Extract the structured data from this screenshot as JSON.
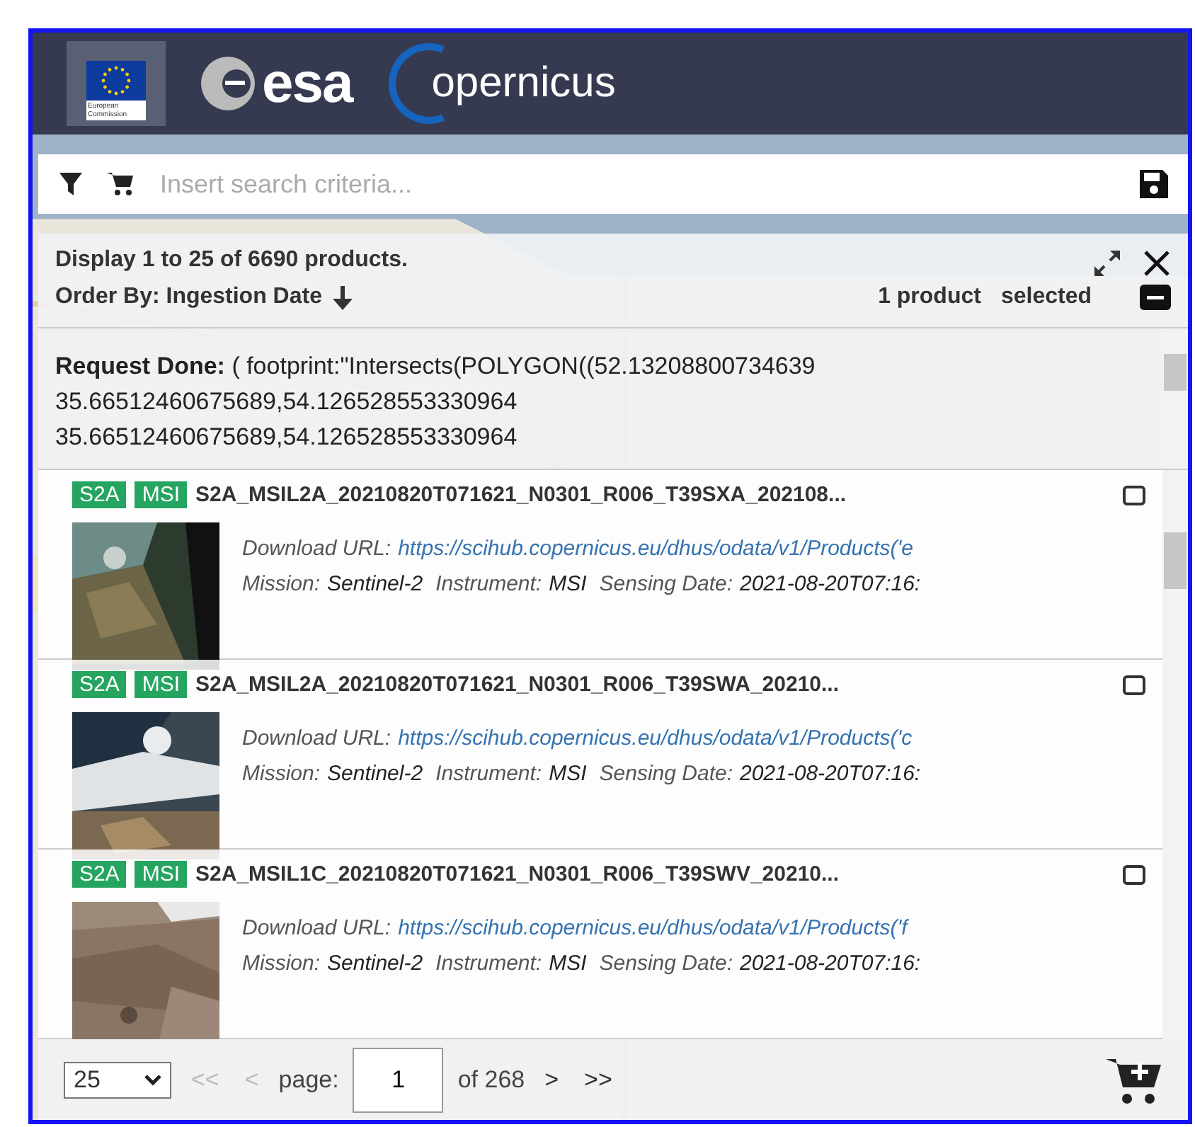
{
  "header": {
    "eu_caption": "European Commission",
    "esa_logo": "esa",
    "copernicus_logo": "opernicus"
  },
  "search": {
    "placeholder": "Insert search criteria..."
  },
  "summary": {
    "display": "Display 1 to 25 of 6690 products.",
    "order_by": "Order By: Ingestion Date",
    "selected_count": "1 product",
    "selected_label": "selected"
  },
  "request": {
    "label": "Request Done:",
    "lines": [
      "( footprint:\"Intersects(POLYGON((52.13208800734639",
      "35.66512460675689,54.126528553330964",
      "35.66512460675689,54.126528553330964"
    ]
  },
  "products": [
    {
      "tags": [
        "S2A",
        "MSI"
      ],
      "title": "S2A_MSIL2A_20210820T071621_N0301_R006_T39SXA_202108...",
      "selected": false,
      "url_label": "Download URL:",
      "url": "https://scihub.copernicus.eu/dhus/odata/v1/Products('e",
      "mission_label": "Mission:",
      "mission": "Sentinel-2",
      "instrument_label": "Instrument:",
      "instrument": "MSI",
      "date_label": "Sensing Date:",
      "date": "2021-08-20T07:16:"
    },
    {
      "tags": [
        "S2A",
        "MSI"
      ],
      "title": "S2A_MSIL2A_20210820T071621_N0301_R006_T39SWA_20210...",
      "selected": false,
      "url_label": "Download URL:",
      "url": "https://scihub.copernicus.eu/dhus/odata/v1/Products('c",
      "mission_label": "Mission:",
      "mission": "Sentinel-2",
      "instrument_label": "Instrument:",
      "instrument": "MSI",
      "date_label": "Sensing Date:",
      "date": "2021-08-20T07:16:"
    },
    {
      "tags": [
        "S2A",
        "MSI"
      ],
      "title": "S2A_MSIL1C_20210820T071621_N0301_R006_T39SWV_20210...",
      "selected": false,
      "url_label": "Download URL:",
      "url": "https://scihub.copernicus.eu/dhus/odata/v1/Products('f",
      "mission_label": "Mission:",
      "mission": "Sentinel-2",
      "instrument_label": "Instrument:",
      "instrument": "MSI",
      "date_label": "Sensing Date:",
      "date": "2021-08-20T07:16:"
    }
  ],
  "pagination": {
    "page_size": "25",
    "first": "<<",
    "prev": "<",
    "page_label": "page:",
    "page": "1",
    "of": "of 268",
    "next": ">",
    "last": ">>",
    "first_disabled": true,
    "prev_disabled": true
  }
}
